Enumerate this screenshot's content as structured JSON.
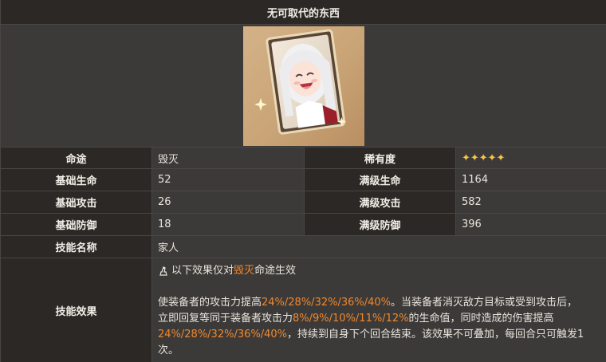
{
  "title": "无可取代的东西",
  "portrait": {
    "icon": "lightcone-portrait"
  },
  "rows": {
    "path": {
      "label": "命途",
      "value": "毁灭"
    },
    "rarity": {
      "label": "稀有度",
      "stars": "✦✦✦✦✦",
      "count": 5
    },
    "hp": {
      "label": "基础生命",
      "value": "52",
      "max_label": "满级生命",
      "max_value": "1164"
    },
    "atk": {
      "label": "基础攻击",
      "value": "26",
      "max_label": "满级攻击",
      "max_value": "582"
    },
    "def": {
      "label": "基础防御",
      "value": "18",
      "max_label": "满级防御",
      "max_value": "396"
    },
    "skill_name": {
      "label": "技能名称",
      "value": "家人"
    },
    "skill_effect": {
      "label": "技能效果",
      "path_prefix": "以下效果仅对",
      "path_name": "毁灭",
      "path_suffix": "命途生效",
      "t1": "使装备者的攻击力提高",
      "h1": "24%/28%/32%/36%/40%",
      "t2": "。当装备者消灭敌方目标或受到攻击后，立即回复等同于装备者攻击力",
      "h2": "8%/9%/10%/11%/12%",
      "t3": "的生命值，同时造成的伤害提高",
      "h3": "24%/28%/32%/36%/40%",
      "t4": "，持续到自身下个回合结束。该效果不可叠加，每回合只可触发1次。"
    }
  },
  "colors": {
    "accent": "#f0882e",
    "star": "#f5c542"
  }
}
